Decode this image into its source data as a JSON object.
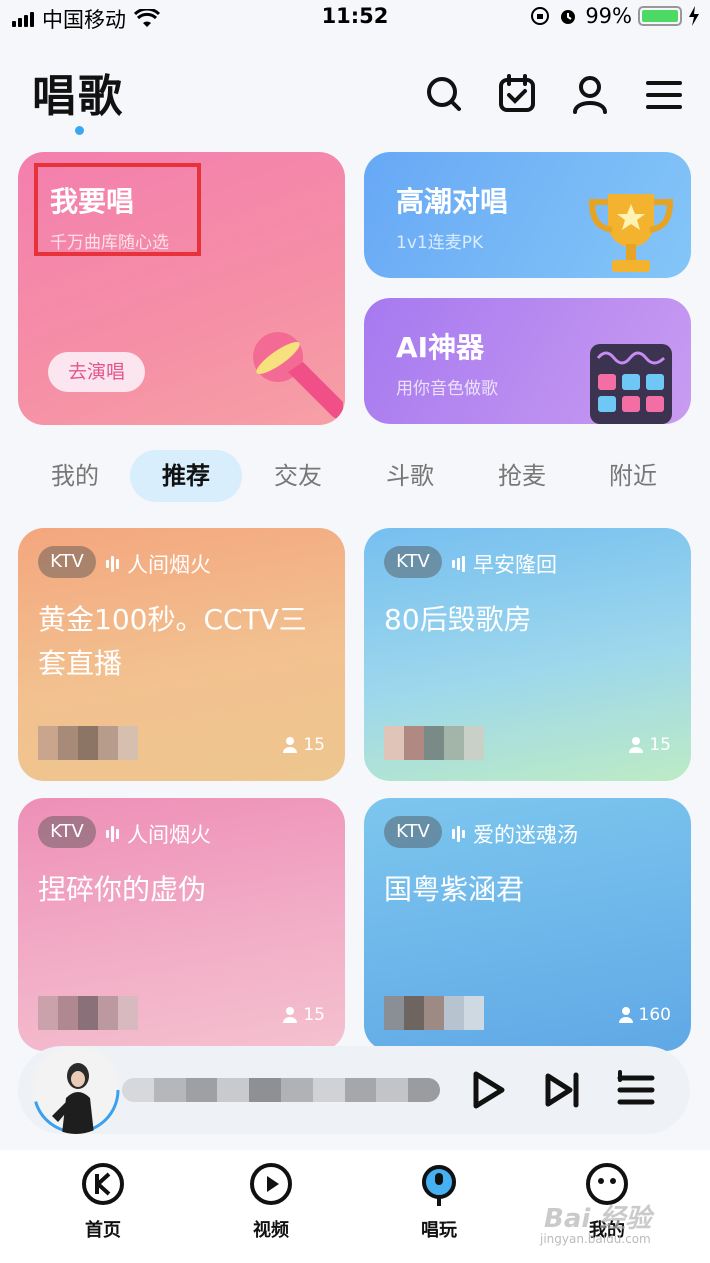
{
  "status_bar": {
    "carrier": "中国移动",
    "time": "11:52",
    "battery": "99%"
  },
  "header": {
    "title": "唱歌"
  },
  "feature_cards": {
    "sing": {
      "title": "我要唱",
      "subtitle": "千万曲库随心选",
      "button": "去演唱"
    },
    "duet": {
      "title": "高潮对唱",
      "subtitle": "1v1连麦PK"
    },
    "ai": {
      "title": "AI神器",
      "subtitle": "用你音色做歌"
    }
  },
  "tabs": [
    "我的",
    "推荐",
    "交友",
    "斗歌",
    "抢麦",
    "附近"
  ],
  "rooms": [
    {
      "tag": "KTV",
      "song": "人间烟火",
      "title": "黄金100秒。CCTV三套直播",
      "count": "15"
    },
    {
      "tag": "KTV",
      "song": "早安隆回",
      "title": "80后毁歌房",
      "count": "15"
    },
    {
      "tag": "KTV",
      "song": "人间烟火",
      "title": "捏碎你的虚伪",
      "count": "15"
    },
    {
      "tag": "KTV",
      "song": "爱的迷魂汤",
      "title": "国粤紫涵君",
      "count": "160"
    }
  ],
  "bottom_nav": [
    "首页",
    "视频",
    "唱玩",
    "我的"
  ],
  "watermark": {
    "text": "Bai 经验",
    "sub": "jingyan.baidu.com"
  }
}
